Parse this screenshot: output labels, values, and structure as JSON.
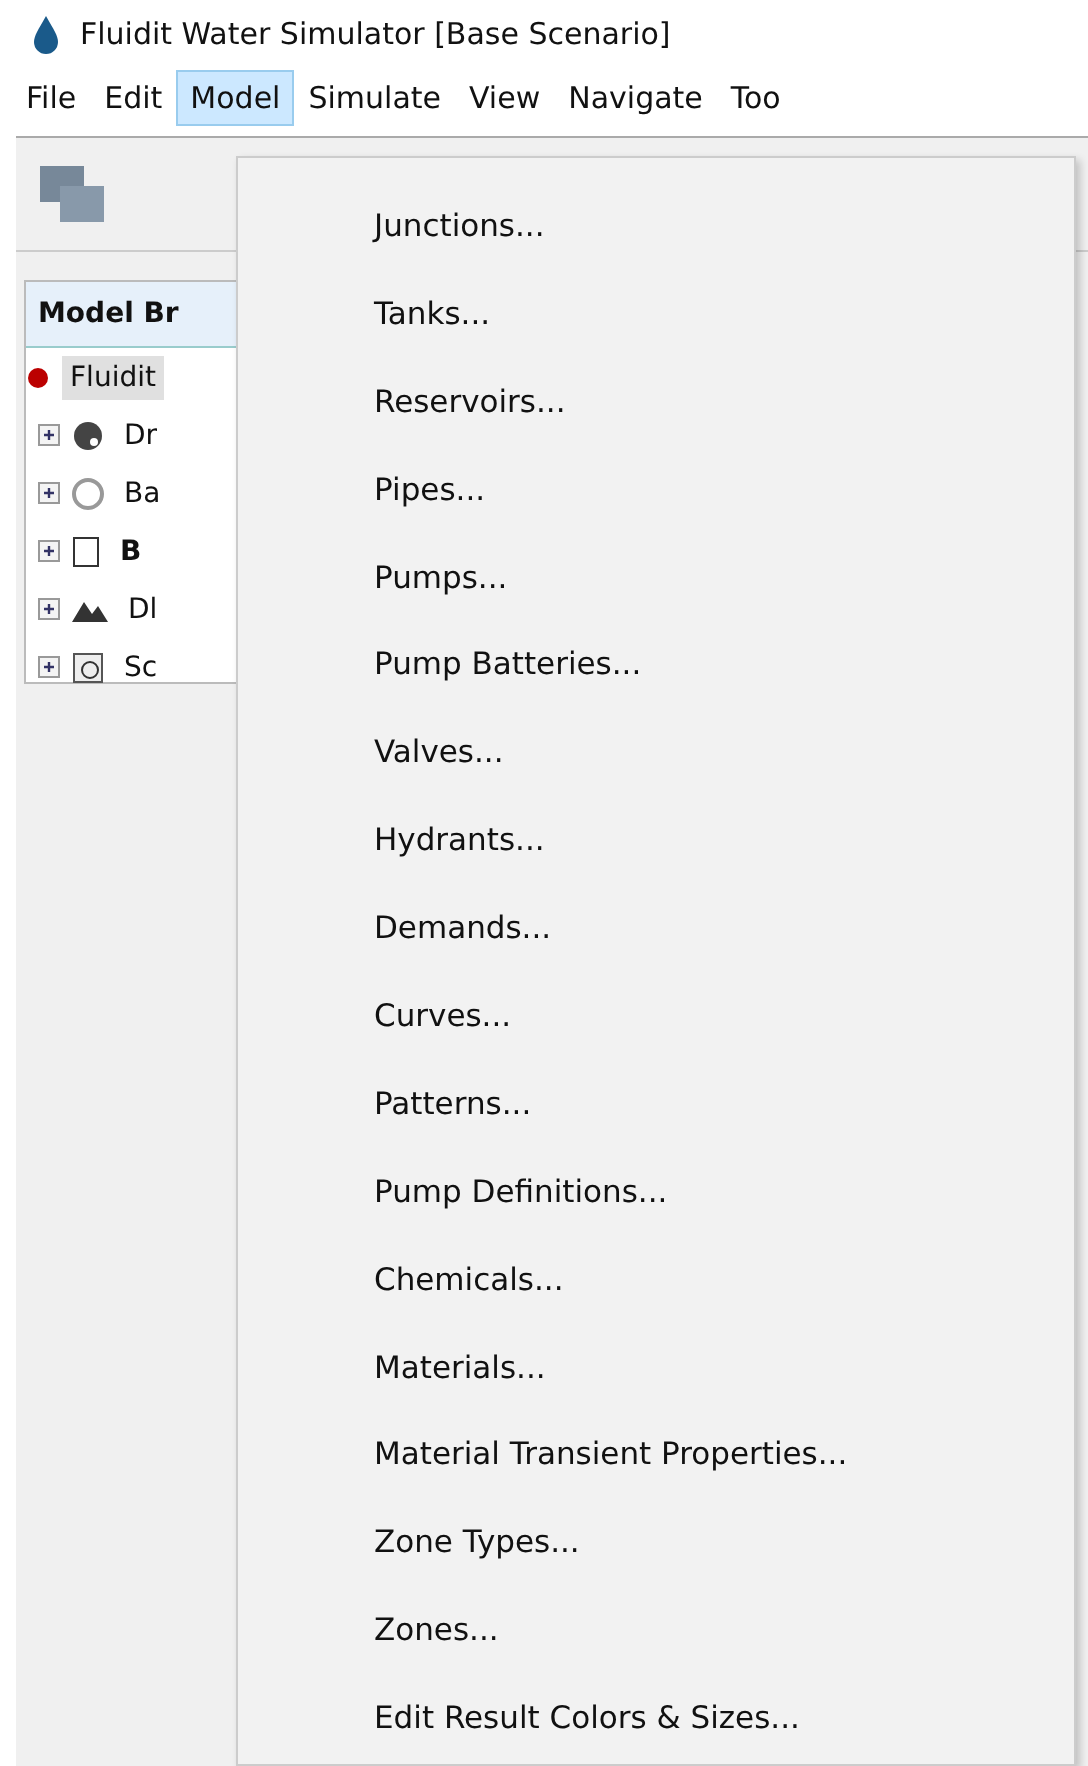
{
  "window": {
    "title": "Fluidit Water Simulator [Base Scenario]"
  },
  "menubar": [
    {
      "label": "File",
      "selected": false
    },
    {
      "label": "Edit",
      "selected": false
    },
    {
      "label": "Model",
      "selected": true
    },
    {
      "label": "Simulate",
      "selected": false
    },
    {
      "label": "View",
      "selected": false
    },
    {
      "label": "Navigate",
      "selected": false
    },
    {
      "label": "Too",
      "selected": false
    }
  ],
  "browser": {
    "title": "Model Br",
    "tree": [
      {
        "label": "Fluidit",
        "kind": "root",
        "bold": false,
        "children": [
          {
            "label": "Dr",
            "kind": "palette",
            "bold": false,
            "expanded": false
          },
          {
            "label": "Ba",
            "kind": "globe",
            "bold": false,
            "expanded": false
          },
          {
            "label": "B",
            "kind": "doc",
            "bold": true,
            "expanded": false
          },
          {
            "label": "Dl",
            "kind": "terrain",
            "bold": false,
            "expanded": false
          },
          {
            "label": "Sc",
            "kind": "clock",
            "bold": false,
            "expanded": false
          }
        ]
      }
    ]
  },
  "menu": [
    "Junctions...",
    "Tanks...",
    "Reservoirs...",
    "Pipes...",
    "Pumps...",
    "Pump Batteries...",
    "Valves...",
    "Hydrants...",
    "Demands...",
    "Curves...",
    "Patterns...",
    "Pump Definitions...",
    "Chemicals...",
    "Materials...",
    "Material Transient Properties...",
    "Zone Types...",
    "Zones...",
    "Edit Result Colors & Sizes..."
  ]
}
